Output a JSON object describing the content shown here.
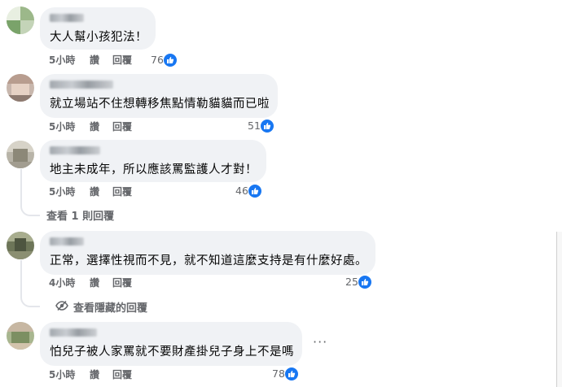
{
  "comments": [
    {
      "text": "大人幫小孩犯法！",
      "time": "5小時",
      "like_label": "讚",
      "reply_label": "回覆",
      "likes": "76"
    },
    {
      "text": "就立場站不住想轉移焦點情勒貓貓而已啦",
      "time": "5小時",
      "like_label": "讚",
      "reply_label": "回覆",
      "likes": "51"
    },
    {
      "text": "地主未成年，所以應該罵監護人才對！",
      "time": "5小時",
      "like_label": "讚",
      "reply_label": "回覆",
      "likes": "46"
    },
    {
      "text": "正常，選擇性視而不見，就不知道這麼支持是有什麼好處。",
      "time": "4小時",
      "like_label": "讚",
      "reply_label": "回覆",
      "likes": "25"
    },
    {
      "text": "怕兒子被人家罵就不要財產掛兒子身上不是嗎",
      "time": "5小時",
      "like_label": "讚",
      "reply_label": "回覆",
      "likes": "78"
    }
  ],
  "view_replies": "查看 1 則回覆",
  "view_hidden": "查看隱藏的回覆",
  "more_options": "···",
  "colors": {
    "bubble": "#f0f2f5",
    "like_blue": "#1877f2",
    "meta_gray": "#65676b"
  },
  "icons": {
    "like": "thumbs-up-icon",
    "hidden": "eye-slash-icon",
    "more": "more-options-icon"
  }
}
